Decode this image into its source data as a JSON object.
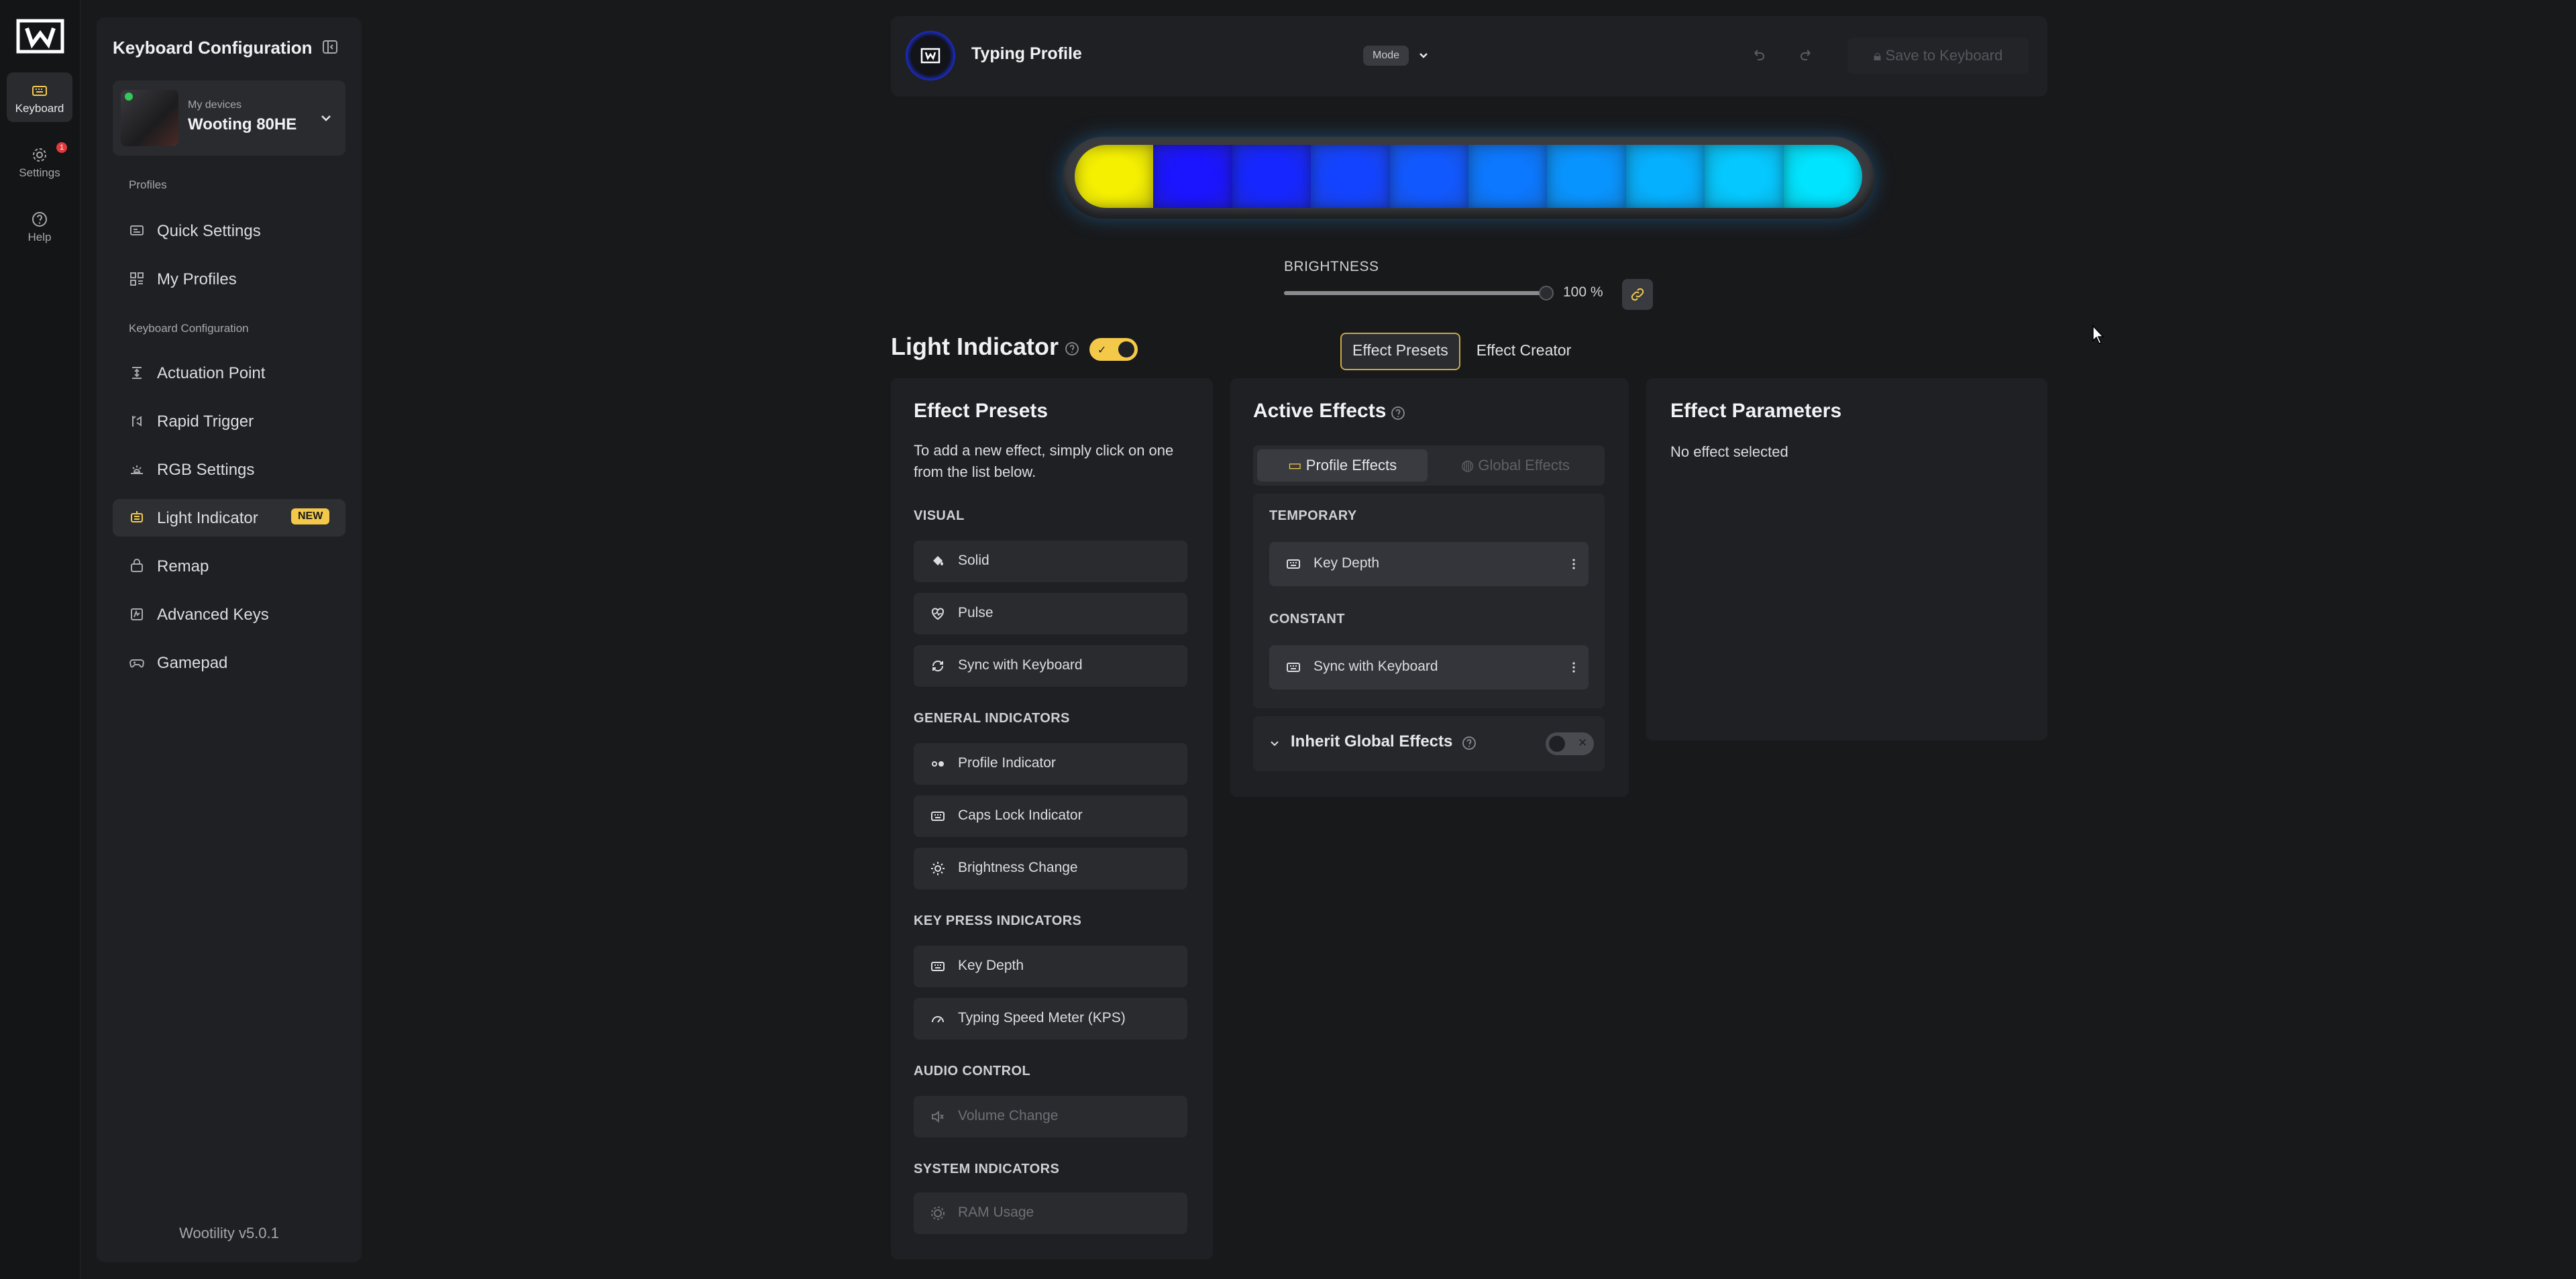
{
  "rail": {
    "items": [
      {
        "label": "Keyboard",
        "icon": "keyboard-icon"
      },
      {
        "label": "Settings",
        "icon": "gear-icon",
        "badge": "1"
      },
      {
        "label": "Help",
        "icon": "help-icon"
      }
    ]
  },
  "sidebar": {
    "title": "Keyboard Configuration",
    "device": {
      "label": "My devices",
      "name": "Wooting 80HE"
    },
    "section_profiles": "Profiles",
    "profile_items": [
      {
        "label": "Quick Settings",
        "icon": "quick-settings-icon"
      },
      {
        "label": "My Profiles",
        "icon": "profiles-grid-icon"
      }
    ],
    "section_keyboard": "Keyboard Configuration",
    "config_items": [
      {
        "label": "Actuation Point",
        "icon": "actuation-icon"
      },
      {
        "label": "Rapid Trigger",
        "icon": "rapid-trigger-icon"
      },
      {
        "label": "RGB Settings",
        "icon": "rgb-icon"
      },
      {
        "label": "Light Indicator",
        "icon": "light-indicator-icon",
        "badge": "NEW"
      },
      {
        "label": "Remap",
        "icon": "remap-icon"
      },
      {
        "label": "Advanced Keys",
        "icon": "advanced-keys-icon"
      },
      {
        "label": "Gamepad",
        "icon": "gamepad-icon"
      }
    ],
    "version": "Wootility v5.0.1"
  },
  "header": {
    "profile_title": "Typing Profile",
    "mode_label": "Mode",
    "save_label": "Save to Keyboard"
  },
  "led_colors": [
    "#f5f000",
    "#1a14ff",
    "#1626ff",
    "#1443ff",
    "#1158ff",
    "#0b78ff",
    "#0894ff",
    "#05b0ff",
    "#04c8ff",
    "#00e4ff"
  ],
  "brightness": {
    "label": "BRIGHTNESS",
    "value_text": "100 %",
    "value": 100
  },
  "light_indicator": {
    "title": "Light Indicator",
    "enabled": true,
    "tabs": [
      "Effect Presets",
      "Effect Creator"
    ],
    "active_tab": "Effect Presets"
  },
  "presets_panel": {
    "title": "Effect Presets",
    "intro": "To add a new effect, simply click on one from the list below.",
    "groups": [
      {
        "name": "VISUAL",
        "items": [
          {
            "label": "Solid",
            "icon": "paint-bucket-icon"
          },
          {
            "label": "Pulse",
            "icon": "heart-pulse-icon"
          },
          {
            "label": "Sync with Keyboard",
            "icon": "sync-icon"
          }
        ]
      },
      {
        "name": "GENERAL INDICATORS",
        "items": [
          {
            "label": "Profile Indicator",
            "icon": "profile-dots-icon"
          },
          {
            "label": "Caps Lock Indicator",
            "icon": "keyboard-icon"
          },
          {
            "label": "Brightness Change",
            "icon": "sun-icon"
          }
        ]
      },
      {
        "name": "KEY PRESS INDICATORS",
        "items": [
          {
            "label": "Key Depth",
            "icon": "keyboard-icon"
          },
          {
            "label": "Typing Speed Meter (KPS)",
            "icon": "gauge-icon"
          }
        ]
      },
      {
        "name": "AUDIO CONTROL",
        "items": [
          {
            "label": "Volume Change",
            "icon": "volume-icon",
            "disabled": true
          }
        ]
      },
      {
        "name": "SYSTEM INDICATORS",
        "items": [
          {
            "label": "RAM Usage",
            "icon": "chip-icon",
            "disabled": true
          }
        ]
      }
    ]
  },
  "active_panel": {
    "title": "Active Effects",
    "tabs": [
      "Profile Effects",
      "Global Effects"
    ],
    "temporary_label": "TEMPORARY",
    "temporary_items": [
      "Key Depth"
    ],
    "constant_label": "CONSTANT",
    "constant_items": [
      "Sync with Keyboard"
    ],
    "inherit_label": "Inherit Global Effects",
    "inherit_enabled": false
  },
  "params_panel": {
    "title": "Effect Parameters",
    "empty_text": "No effect selected"
  }
}
